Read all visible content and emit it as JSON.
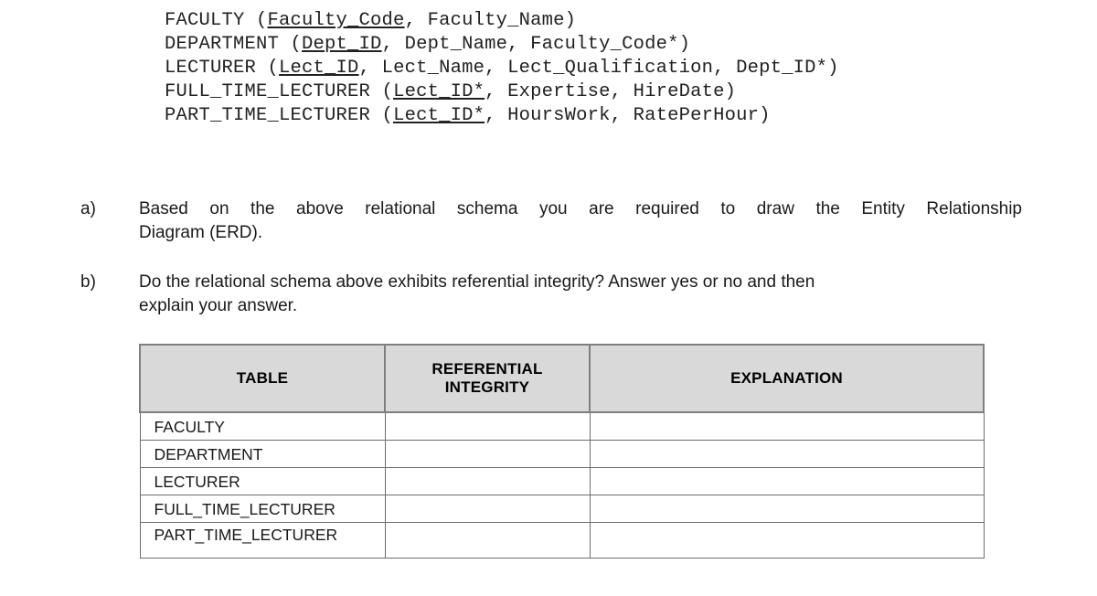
{
  "schema": {
    "title": "relational schema",
    "lines": [
      {
        "relation": "FACULTY",
        "open": " (",
        "pk": "Faculty_Code",
        "rest": ", Faculty_Name)"
      },
      {
        "relation": "DEPARTMENT",
        "open": " (",
        "pk": "Dept_ID",
        "rest": ", Dept_Name, Faculty_Code*)"
      },
      {
        "relation": "LECTURER",
        "open": " (",
        "pk": "Lect_ID",
        "rest": ", Lect_Name, Lect_Qualification, Dept_ID*)"
      },
      {
        "relation": "FULL_TIME_LECTURER",
        "open": " (",
        "pk": "Lect_ID*",
        "rest": ", Expertise, HireDate)"
      },
      {
        "relation": "PART_TIME_LECTURER",
        "open": " (",
        "pk": "Lect_ID*",
        "rest": ", HoursWork, RatePerHour)"
      }
    ]
  },
  "questions": [
    {
      "label": "a)",
      "line1": "Based on the above relational schema you are required to draw the Entity Relationship",
      "line2": "Diagram (ERD)."
    },
    {
      "label": "b)",
      "line1": "Do the relational schema above exhibits referential integrity? Answer yes or no and then",
      "line2": "explain your answer."
    }
  ],
  "table": {
    "headers": [
      {
        "text": "TABLE"
      },
      {
        "text": "REFERENTIAL",
        "text2": "INTEGRITY"
      },
      {
        "text": "EXPLANATION"
      }
    ],
    "rows": [
      {
        "name": "FACULTY",
        "referential_integrity": "",
        "explanation": ""
      },
      {
        "name": "DEPARTMENT",
        "referential_integrity": "",
        "explanation": ""
      },
      {
        "name": "LECTURER",
        "referential_integrity": "",
        "explanation": ""
      },
      {
        "name": "FULL_TIME_LECTURER",
        "referential_integrity": "",
        "explanation": ""
      },
      {
        "name": "PART_TIME_LECTURER",
        "referential_integrity": "",
        "explanation": ""
      }
    ]
  },
  "colors": {
    "header_fill": "#d9d9d9",
    "header_border": "#7f7f7f",
    "cell_border": "#6e6e6e",
    "text": "#1a1a1a",
    "page_background": "#ffffff"
  }
}
